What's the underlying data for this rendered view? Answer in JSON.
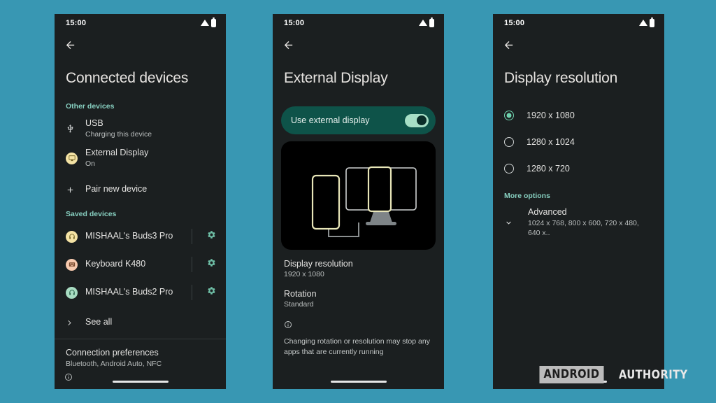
{
  "theme": {
    "page_background": "#3897b3",
    "phone_background": "#1b1f20",
    "accent_green": "#87cfc0",
    "toggle_card": "#0e5349",
    "illustration_background": "#000000",
    "illustration_stroke": "#e8e6b8"
  },
  "status_bar": {
    "time": "15:00",
    "wifi_icon": "wifi-icon",
    "battery_icon": "battery-icon"
  },
  "phone1": {
    "back_icon": "back-arrow-icon",
    "title": "Connected devices",
    "section_other": "Other devices",
    "other_devices": [
      {
        "icon": "usb-icon",
        "title": "USB",
        "subtitle": "Charging this device"
      },
      {
        "icon": "external-display-icon",
        "title": "External Display",
        "subtitle": "On"
      }
    ],
    "pair_new_device": {
      "icon": "plus-icon",
      "label": "Pair new device"
    },
    "section_saved": "Saved devices",
    "saved_devices": [
      {
        "icon": "headphones-icon",
        "avatar_color": "#f4e3a5",
        "label": "MISHAAL's Buds3 Pro",
        "settings_icon": "gear-icon"
      },
      {
        "icon": "keyboard-icon",
        "avatar_color": "#f6c9ae",
        "label": "Keyboard K480",
        "settings_icon": "gear-icon"
      },
      {
        "icon": "headphones-icon",
        "avatar_color": "#a8dcc2",
        "label": "MISHAAL's Buds2 Pro",
        "settings_icon": "gear-icon"
      }
    ],
    "see_all": {
      "icon": "chevron-right-icon",
      "label": "See all"
    },
    "connection_preferences": {
      "title": "Connection preferences",
      "subtitle": "Bluetooth, Android Auto, NFC"
    },
    "info_icon": "info-icon"
  },
  "phone2": {
    "back_icon": "back-arrow-icon",
    "title": "External Display",
    "toggle": {
      "label": "Use external display",
      "state": "on"
    },
    "illustration": "phone-connected-to-monitor-illustration",
    "details": [
      {
        "title": "Display resolution",
        "value": "1920 x 1080"
      },
      {
        "title": "Rotation",
        "value": "Standard"
      }
    ],
    "info_icon": "info-icon",
    "note": "Changing rotation or resolution may stop any apps that are currently running"
  },
  "phone3": {
    "back_icon": "back-arrow-icon",
    "title": "Display resolution",
    "options": [
      {
        "label": "1920 x 1080",
        "selected": true
      },
      {
        "label": "1280 x 1024",
        "selected": false
      },
      {
        "label": "1280 x 720",
        "selected": false
      }
    ],
    "more_options_label": "More options",
    "advanced": {
      "icon": "chevron-down-icon",
      "title": "Advanced",
      "subtitle": "1024 x 768, 800 x 600, 720 x 480, 640 x.."
    }
  },
  "watermark": {
    "part1": "ANDROID",
    "part2": "AUTHORITY"
  }
}
